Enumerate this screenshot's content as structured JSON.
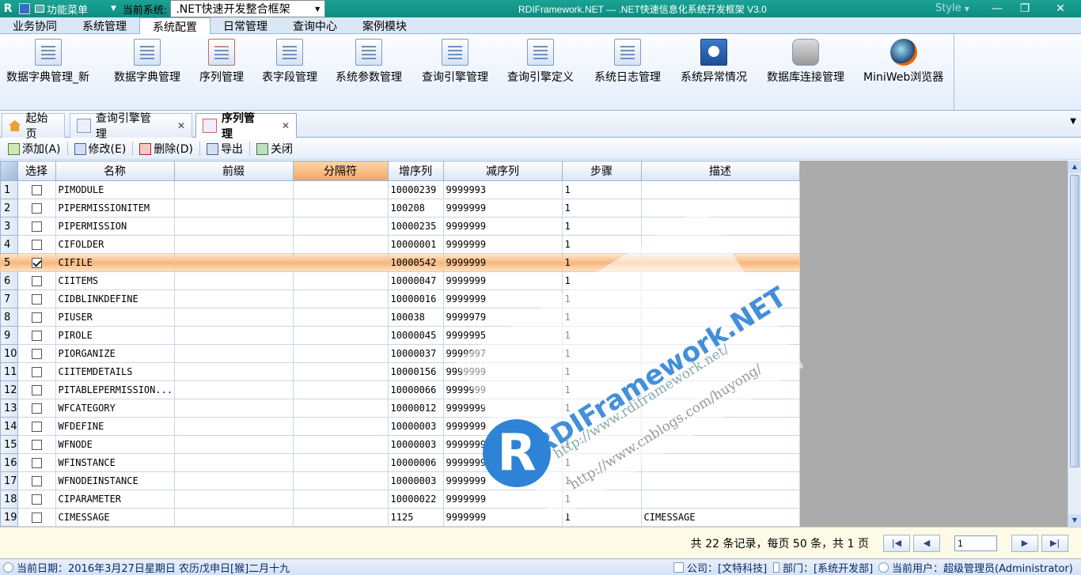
{
  "titlebar": {
    "logo": "R",
    "menu_label": "功能菜单",
    "current_system_label": "当前系统:",
    "current_system": ".NET快速开发整合框架",
    "title": "RDIFramework.NET — .NET快速信息化系统开发框架 V3.0",
    "style_label": "Style"
  },
  "menu_tabs": [
    {
      "label": "业务协同"
    },
    {
      "label": "系统管理"
    },
    {
      "label": "系统配置"
    },
    {
      "label": "日常管理"
    },
    {
      "label": "查询中心"
    },
    {
      "label": "案例模块"
    }
  ],
  "ribbon": [
    {
      "label": "数据字典管理_新",
      "icon": "dictionary-new-icon"
    },
    {
      "label": "数据字典管理",
      "icon": "dictionary-icon"
    },
    {
      "label": "序列管理",
      "icon": "sequence-icon"
    },
    {
      "label": "表字段管理",
      "icon": "table-field-icon"
    },
    {
      "label": "系统参数管理",
      "icon": "parameter-icon"
    },
    {
      "label": "查询引擎管理",
      "icon": "query-engine-icon"
    },
    {
      "label": "查询引擎定义",
      "icon": "query-define-icon"
    },
    {
      "label": "系统日志管理",
      "icon": "log-icon"
    },
    {
      "label": "系统异常情况",
      "icon": "exception-icon"
    },
    {
      "label": "数据库连接管理",
      "icon": "database-icon"
    },
    {
      "label": "MiniWeb浏览器",
      "icon": "browser-icon"
    }
  ],
  "page_tabs": [
    {
      "label": "起始页"
    },
    {
      "label": "查询引擎管理"
    },
    {
      "label": "序列管理"
    }
  ],
  "toolbar": {
    "add": "添加(A)",
    "edit": "修改(E)",
    "delete": "删除(D)",
    "export": "导出",
    "close": "关闭"
  },
  "grid": {
    "columns": [
      "选择",
      "名称",
      "前缀",
      "分隔符",
      "增序列",
      "减序列",
      "步骤",
      "描述"
    ],
    "rows": [
      {
        "n": "1",
        "checked": false,
        "name": "PIMODULE",
        "prefix": "",
        "sep": "",
        "inc": "10000239",
        "dec": "9999993",
        "step": "1",
        "desc": ""
      },
      {
        "n": "2",
        "checked": false,
        "name": "PIPERMISSIONITEM",
        "prefix": "",
        "sep": "",
        "inc": "100208",
        "dec": "9999999",
        "step": "1",
        "desc": ""
      },
      {
        "n": "3",
        "checked": false,
        "name": "PIPERMISSION",
        "prefix": "",
        "sep": "",
        "inc": "10000235",
        "dec": "9999999",
        "step": "1",
        "desc": ""
      },
      {
        "n": "4",
        "checked": false,
        "name": "CIFOLDER",
        "prefix": "",
        "sep": "",
        "inc": "10000001",
        "dec": "9999999",
        "step": "1",
        "desc": ""
      },
      {
        "n": "5",
        "checked": true,
        "name": "CIFILE",
        "prefix": "",
        "sep": "",
        "inc": "10000542",
        "dec": "9999999",
        "step": "1",
        "desc": ""
      },
      {
        "n": "6",
        "checked": false,
        "name": "CIITEMS",
        "prefix": "",
        "sep": "",
        "inc": "10000047",
        "dec": "9999999",
        "step": "1",
        "desc": ""
      },
      {
        "n": "7",
        "checked": false,
        "name": "CIDBLINKDEFINE",
        "prefix": "",
        "sep": "",
        "inc": "10000016",
        "dec": "9999999",
        "step": "1",
        "desc": ""
      },
      {
        "n": "8",
        "checked": false,
        "name": "PIUSER",
        "prefix": "",
        "sep": "",
        "inc": "100038",
        "dec": "9999979",
        "step": "1",
        "desc": ""
      },
      {
        "n": "9",
        "checked": false,
        "name": "PIROLE",
        "prefix": "",
        "sep": "",
        "inc": "10000045",
        "dec": "9999995",
        "step": "1",
        "desc": ""
      },
      {
        "n": "10",
        "checked": false,
        "name": "PIORGANIZE",
        "prefix": "",
        "sep": "",
        "inc": "10000037",
        "dec": "9999997",
        "step": "1",
        "desc": ""
      },
      {
        "n": "11",
        "checked": false,
        "name": "CIITEMDETAILS",
        "prefix": "",
        "sep": "",
        "inc": "10000156",
        "dec": "9999999",
        "step": "1",
        "desc": ""
      },
      {
        "n": "12",
        "checked": false,
        "name": "PITABLEPERMISSION...",
        "prefix": "",
        "sep": "",
        "inc": "10000066",
        "dec": "9999999",
        "step": "1",
        "desc": ""
      },
      {
        "n": "13",
        "checked": false,
        "name": "WFCATEGORY",
        "prefix": "",
        "sep": "",
        "inc": "10000012",
        "dec": "9999999",
        "step": "1",
        "desc": ""
      },
      {
        "n": "14",
        "checked": false,
        "name": "WFDEFINE",
        "prefix": "",
        "sep": "",
        "inc": "10000003",
        "dec": "9999999",
        "step": "1",
        "desc": ""
      },
      {
        "n": "15",
        "checked": false,
        "name": "WFNODE",
        "prefix": "",
        "sep": "",
        "inc": "10000003",
        "dec": "9999999",
        "step": "1",
        "desc": ""
      },
      {
        "n": "16",
        "checked": false,
        "name": "WFINSTANCE",
        "prefix": "",
        "sep": "",
        "inc": "10000006",
        "dec": "9999999",
        "step": "1",
        "desc": ""
      },
      {
        "n": "17",
        "checked": false,
        "name": "WFNODEINSTANCE",
        "prefix": "",
        "sep": "",
        "inc": "10000003",
        "dec": "9999999",
        "step": "1",
        "desc": ""
      },
      {
        "n": "18",
        "checked": false,
        "name": "CIPARAMETER",
        "prefix": "",
        "sep": "",
        "inc": "10000022",
        "dec": "9999999",
        "step": "1",
        "desc": ""
      },
      {
        "n": "19",
        "checked": false,
        "name": "CIMESSAGE",
        "prefix": "",
        "sep": "",
        "inc": "1125",
        "dec": "9999999",
        "step": "1",
        "desc": "CIMESSAGE"
      }
    ]
  },
  "pager": {
    "summary": "共 22 条记录，每页 50 条，共 1 页",
    "page": "1",
    "first": "|◀",
    "prev": "◀",
    "next": "▶",
    "last": "▶|"
  },
  "watermark": {
    "logo": "R",
    "brand": "RDIFramework.NET",
    "url1": "http://www.rdiframework.net/",
    "url2": "http://www.cnblogs.com/huyong/"
  },
  "status": {
    "date": "当前日期：2016年3月27日星期日 农历戊申日[猴]二月十九",
    "company": "公司：[文特科技]",
    "dept": "部门：[系统开发部]",
    "user": "当前用户：超级管理员(Administrator)"
  },
  "colors": {
    "titlebar": "#12998a",
    "selected_row": "#f8b67a",
    "sorted_header": "#f4a462"
  }
}
